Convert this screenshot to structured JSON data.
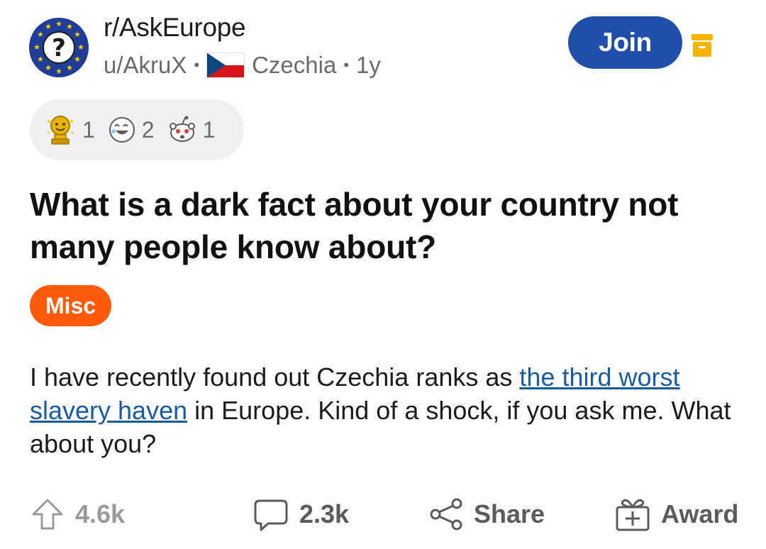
{
  "header": {
    "subreddit": "r/AskEurope",
    "author": "u/AkruX",
    "flair_country": "Czechia",
    "age": "1y",
    "join_label": "Join"
  },
  "awards": [
    {
      "icon": "gold-trophy-icon",
      "count": "1"
    },
    {
      "icon": "laughing-face-icon",
      "count": "2"
    },
    {
      "icon": "snoo-shocked-icon",
      "count": "1"
    }
  ],
  "post": {
    "title": "What is a dark fact about your country not many people know about?",
    "flair": "Misc",
    "body_before_link": "I have recently found out Czechia ranks as ",
    "link_text": "the third worst slavery haven",
    "body_after_link": " in Europe. Kind of a shock, if you ask me. What about you?"
  },
  "actions": {
    "upvotes": "4.6k",
    "comments": "2.3k",
    "share": "Share",
    "award": "Award"
  },
  "colors": {
    "join_bg": "#1f4fa8",
    "flair_bg": "#ff5a0a",
    "link": "#1a5c9e",
    "archive_icon": "#f5b400",
    "eu_blue": "#1f3c99",
    "eu_star": "#f5d000"
  }
}
